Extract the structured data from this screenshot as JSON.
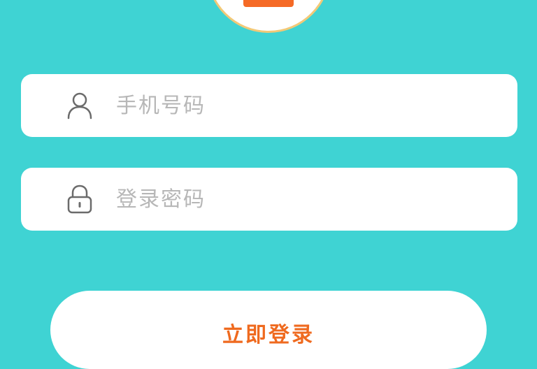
{
  "logo": {
    "icon": "app-logo",
    "accent_color": "#f56a26",
    "ring_color": "#f2c978"
  },
  "login_form": {
    "phone": {
      "icon": "user-icon",
      "placeholder": "手机号码",
      "value": ""
    },
    "password": {
      "icon": "lock-icon",
      "placeholder": "登录密码",
      "value": ""
    },
    "submit_label": "立即登录"
  },
  "colors": {
    "background": "#3fd3d3",
    "button_text": "#ef6a1f",
    "placeholder": "#b7b7b7",
    "icon": "#6b6b6b"
  }
}
